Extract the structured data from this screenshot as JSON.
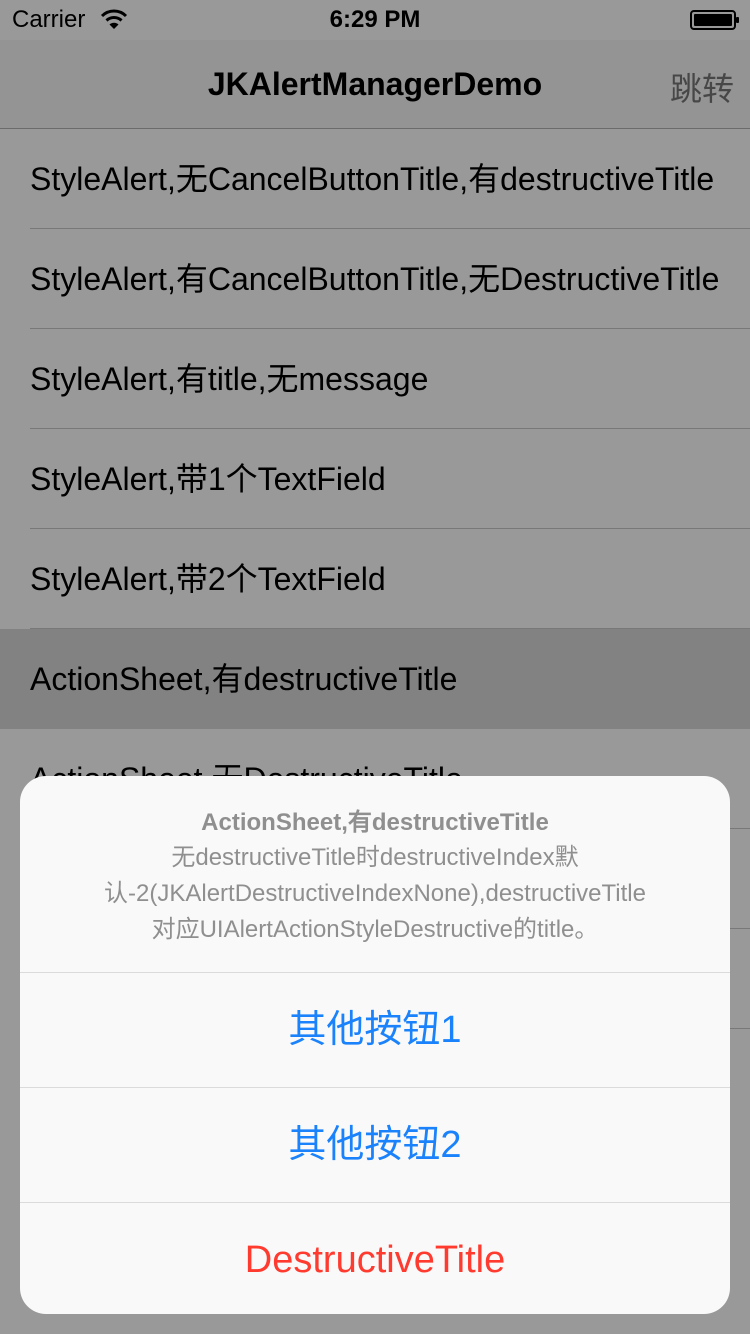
{
  "status_bar": {
    "carrier": "Carrier",
    "time": "6:29 PM"
  },
  "nav_bar": {
    "title": "JKAlertManagerDemo",
    "right_button": "跳转"
  },
  "table": {
    "rows": [
      {
        "label": "StyleAlert,无CancelButtonTitle,有destructiveTitle"
      },
      {
        "label": "StyleAlert,有CancelButtonTitle,无DestructiveTitle"
      },
      {
        "label": "StyleAlert,有title,无message"
      },
      {
        "label": "StyleAlert,带1个TextField"
      },
      {
        "label": "StyleAlert,带2个TextField"
      },
      {
        "label": "ActionSheet,有destructiveTitle"
      },
      {
        "label": "ActionSheet,无DestructiveTitle"
      },
      {
        "label": ""
      },
      {
        "label": ""
      }
    ]
  },
  "action_sheet": {
    "title": "ActionSheet,有destructiveTitle",
    "message_line1": "无destructiveTitle时destructiveIndex默",
    "message_line2": "认-2(JKAlertDestructiveIndexNone),destructiveTitle",
    "message_line3": "对应UIAlertActionStyleDestructive的title。",
    "buttons": [
      {
        "label": "其他按钮1"
      },
      {
        "label": "其他按钮2"
      },
      {
        "label": "DestructiveTitle"
      }
    ]
  },
  "colors": {
    "accent": "#1a82fb",
    "destructive": "#ff3b30"
  }
}
